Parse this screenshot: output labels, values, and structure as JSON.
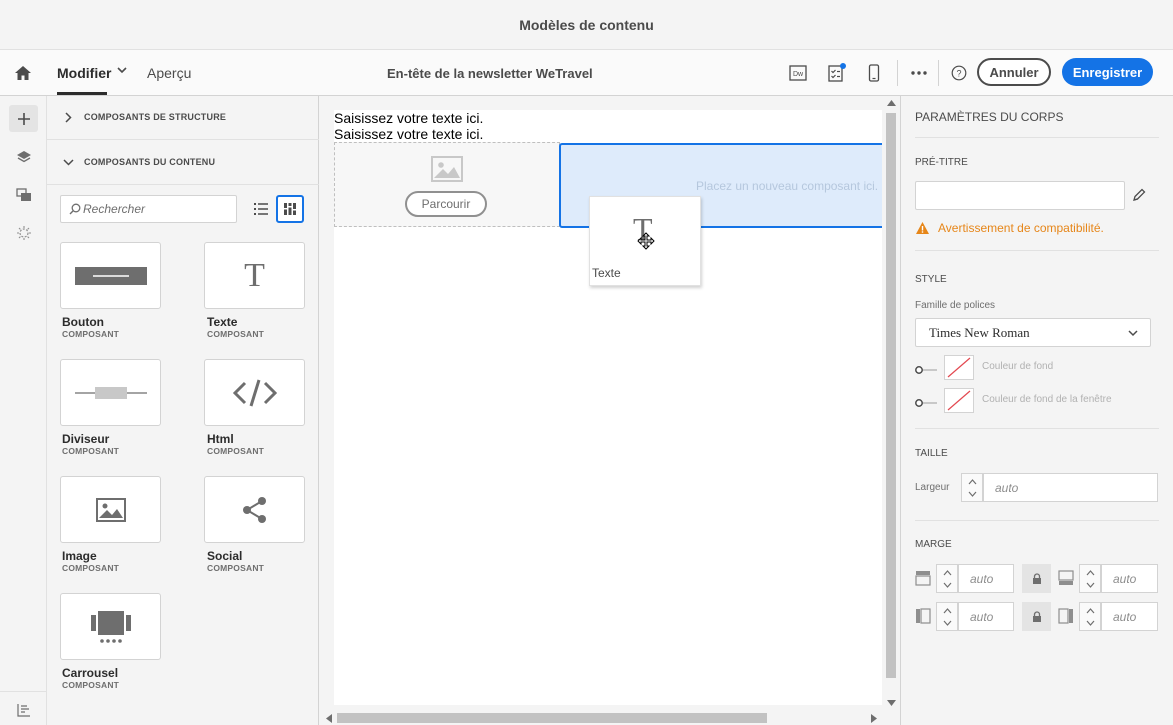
{
  "window": {
    "title": "Modèles de contenu"
  },
  "toolbar": {
    "home_icon": "home-icon",
    "modifier_label": "Modifier",
    "apercu_label": "Aperçu",
    "doc_title": "En-tête de la newsletter WeTravel",
    "dw_icon_text": "Dw",
    "cancel_label": "Annuler",
    "save_label": "Enregistrer",
    "accent": "#1473e6"
  },
  "rail": {
    "items": [
      "add-icon",
      "layers-icon",
      "assets-icon",
      "fragments-icon",
      "settings-icon"
    ]
  },
  "left_panel": {
    "structure_header": "COMPOSANTS DE STRUCTURE",
    "content_header": "COMPOSANTS DU CONTENU",
    "search_placeholder": "Rechercher",
    "components": [
      {
        "label": "Bouton",
        "sub": "COMPOSANT"
      },
      {
        "label": "Texte",
        "sub": "COMPOSANT"
      },
      {
        "label": "Diviseur",
        "sub": "COMPOSANT"
      },
      {
        "label": "Html",
        "sub": "COMPOSANT"
      },
      {
        "label": "Image",
        "sub": "COMPOSANT"
      },
      {
        "label": "Social",
        "sub": "COMPOSANT"
      },
      {
        "label": "Carrousel",
        "sub": "COMPOSANT"
      }
    ]
  },
  "canvas": {
    "text_line_1": "Saisissez votre texte ici.",
    "text_line_2": "Saisissez votre texte ici.",
    "browse_label": "Parcourir",
    "drop_hint": "Placez un nouveau composant ici.",
    "drag_label": "Texte",
    "drag_glyph": "T"
  },
  "right_panel": {
    "title": "PARAMÈTRES DU CORPS",
    "pretitle_header": "PRÉ-TITRE",
    "pretitle_value": "",
    "warning": "Avertissement de compatibilité.",
    "style_header": "STYLE",
    "font_family_label": "Famille de polices",
    "font_family_value": "Times New Roman",
    "bg_color_label": "Couleur de fond",
    "window_bg_color_label": "Couleur de fond de la fenêtre",
    "size_header": "TAILLE",
    "width_label": "Largeur",
    "width_placeholder": "auto",
    "margin_header": "MARGE",
    "margin_top": "auto",
    "margin_bottom": "auto",
    "margin_left": "auto",
    "margin_right": "auto",
    "warning_color": "#e68619"
  }
}
